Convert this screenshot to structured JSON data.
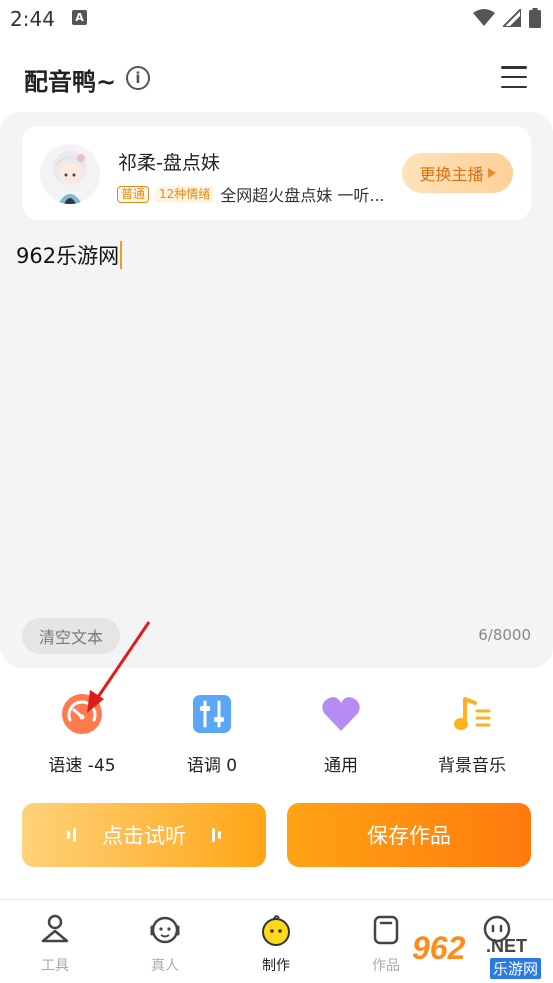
{
  "status_bar": {
    "time": "2:44",
    "app_icon_letter": "A"
  },
  "header": {
    "title": "配音鸭~",
    "info_icon": "info-icon",
    "menu_icon": "menu-icon"
  },
  "anchor": {
    "name": "祁柔-盘点妹",
    "tag_normal": "普通",
    "tag_emotion": "12种情绪",
    "description": "全网超火盘点妹 一听...",
    "change_button": "更换主播"
  },
  "editor": {
    "text": "962乐游网",
    "clear_button": "清空文本",
    "char_count": "6/8000"
  },
  "tools": [
    {
      "label": "语速 -45",
      "icon": "speed-gauge-icon",
      "color": "#ff7a4d"
    },
    {
      "label": "语调 0",
      "icon": "tone-sliders-icon",
      "color": "#5aa8f5"
    },
    {
      "label": "通用",
      "icon": "heart-icon",
      "color": "#b48cf2"
    },
    {
      "label": "背景音乐",
      "icon": "music-note-icon",
      "color": "#ffb21f"
    }
  ],
  "actions": {
    "listen": "点击试听",
    "save": "保存作品"
  },
  "nav": [
    {
      "label": "工具",
      "icon": "tools-icon",
      "active": false
    },
    {
      "label": "真人",
      "icon": "person-icon",
      "active": false
    },
    {
      "label": "制作",
      "icon": "duck-icon",
      "active": true
    },
    {
      "label": "作品",
      "icon": "works-icon",
      "active": false
    },
    {
      "label": "",
      "icon": "chat-icon",
      "active": false
    }
  ],
  "watermark": {
    "number": "962",
    "net": ".NET",
    "site": "乐游网"
  },
  "colors": {
    "accent": "#ff9a17",
    "annotation_arrow": "#e01b1b"
  }
}
